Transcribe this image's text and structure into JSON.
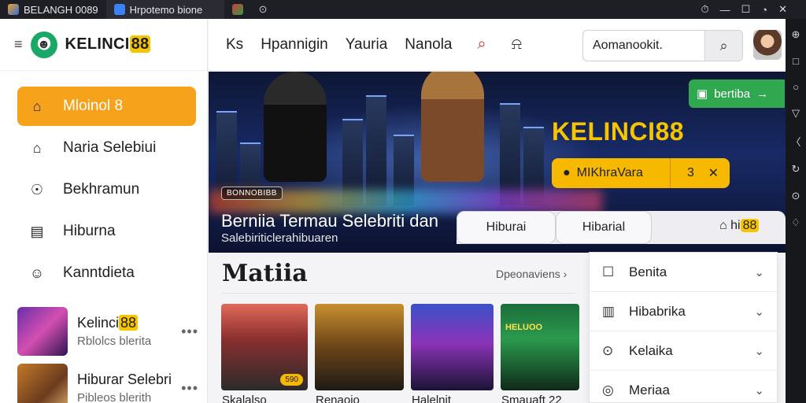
{
  "titlebar": {
    "tabs": [
      {
        "label": "BELANGH 0089"
      },
      {
        "label": "Hrpotemo bione"
      },
      {
        "label": ""
      },
      {
        "label": "⊙"
      }
    ],
    "controls": [
      "⏱",
      "—",
      "☐",
      "◔",
      "✕"
    ]
  },
  "sidebar": {
    "brand": {
      "name": "KELINCI",
      "num": "88",
      "menu_icon": "≡"
    },
    "items": [
      {
        "label": "Mloinol 8",
        "icon": "home-icon",
        "glyph": "⌂",
        "active": true
      },
      {
        "label": "Naria Selebiui",
        "icon": "house-outline-icon",
        "glyph": "⌂"
      },
      {
        "label": "Bekhramun",
        "icon": "chat-icon",
        "glyph": "☉"
      },
      {
        "label": "Hiburna",
        "icon": "document-icon",
        "glyph": "▤"
      },
      {
        "label": "Kanntdieta",
        "icon": "people-icon",
        "glyph": "☺"
      }
    ],
    "media": [
      {
        "title": "Kelinci",
        "num": "88",
        "subtitle": "Rblolcs blerita"
      },
      {
        "title": "Hiburar Selebri",
        "num": "",
        "subtitle": "Pibleos blerith"
      }
    ],
    "more_glyph": "•••"
  },
  "header": {
    "links": [
      "Ks",
      "Hpannigin",
      "Yauria",
      "Nanola"
    ],
    "search_placeholder": "Aomanookit.",
    "search_glyph": "⌕",
    "bell_glyph": "⍾"
  },
  "hero": {
    "badge": "BONNOBIBB",
    "title": "Berniia Termau Selebriti dan",
    "subtitle": "Salebiriticlerahibuaren",
    "brand": "KELINCI88",
    "promo_label": "MIKhraVara",
    "promo_num": "3",
    "cta_label": "bertiba",
    "cta_arrow": "→"
  },
  "categories": {
    "pills": [
      "Hiburai",
      "Hibarial"
    ],
    "home_label": "hi",
    "home_num": "88"
  },
  "section": {
    "title": "Matiia",
    "see_all": "Dpeonaviens ›",
    "cards": [
      {
        "caption": "Skalalso",
        "tag": "590",
        "inner": ""
      },
      {
        "caption": "Renaoio",
        "tag": "",
        "inner": ""
      },
      {
        "caption": "Halelnit",
        "tag": "",
        "inner": ""
      },
      {
        "caption": "Smauaft 22",
        "tag": "",
        "inner": "HELUOO"
      }
    ]
  },
  "dropdown": {
    "items": [
      {
        "label": "Benita",
        "icon": "search-doc-icon",
        "glyph": "☐"
      },
      {
        "label": "Hibabrika",
        "icon": "file-icon",
        "glyph": "▥"
      },
      {
        "label": "Kelaika",
        "icon": "location-icon",
        "glyph": "⊙"
      },
      {
        "label": "Meriaa",
        "icon": "camera-icon",
        "glyph": "◎"
      }
    ],
    "chevron": "⌄"
  },
  "rail": {
    "glyphs": [
      "⊕",
      "□",
      "○",
      "▽",
      "〈",
      "↻",
      "⊙",
      "♢"
    ]
  },
  "colors": {
    "accent": "#f6a21a",
    "brand_yellow": "#f7c400",
    "green": "#2fa84f",
    "hero_bg": "#182a66"
  }
}
